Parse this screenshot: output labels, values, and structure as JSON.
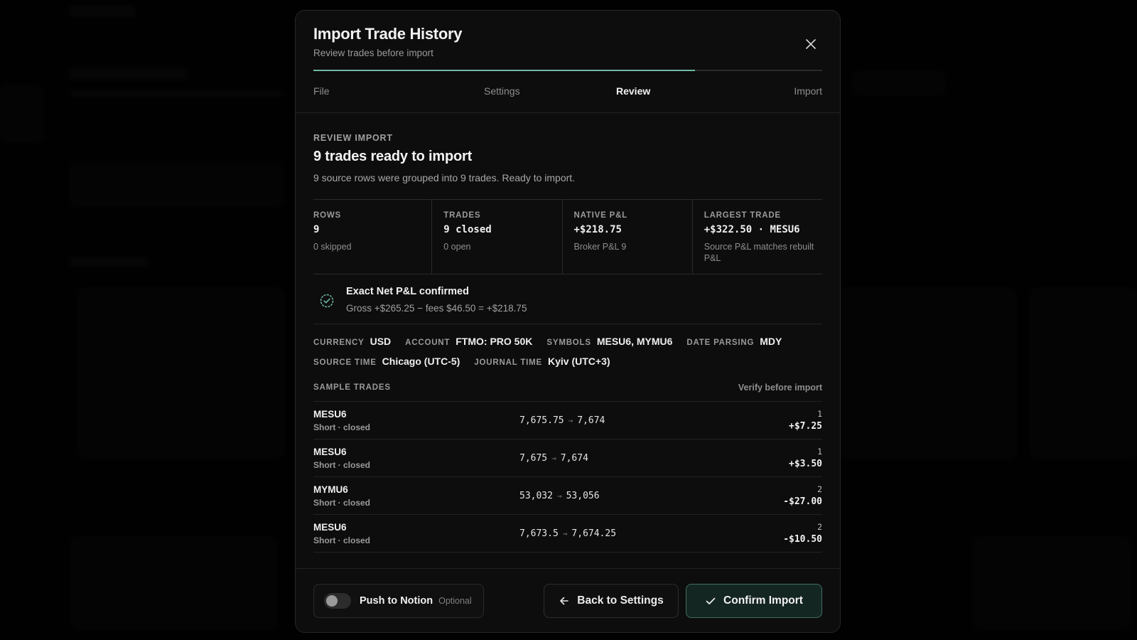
{
  "modal": {
    "title": "Import Trade History",
    "subtitle": "Review trades before import",
    "accent_color": "#6fb8a5",
    "progress_fraction": 0.75
  },
  "steps": [
    {
      "label": "File",
      "active": false
    },
    {
      "label": "Settings",
      "active": false
    },
    {
      "label": "Review",
      "active": true
    },
    {
      "label": "Import",
      "active": false
    }
  ],
  "review": {
    "eyebrow": "REVIEW IMPORT",
    "heading": "9 trades ready to import",
    "description": "9 source rows were grouped into 9 trades. Ready to import."
  },
  "stats": [
    {
      "label": "ROWS",
      "value": "9",
      "sub": "0 skipped"
    },
    {
      "label": "TRADES",
      "value": "9 closed",
      "sub": "0 open"
    },
    {
      "label": "NATIVE P&L",
      "value": "+$218.75",
      "sub": "Broker P&L 9"
    },
    {
      "label": "LARGEST TRADE",
      "value": "+$322.50 · MESU6",
      "sub": "Source P&L matches rebuilt P&L"
    }
  ],
  "confirmation": {
    "icon": "check-circle-icon",
    "title": "Exact Net P&L confirmed",
    "formula": "Gross +$265.25 − fees $46.50 = +$218.75"
  },
  "meta": {
    "line1": [
      {
        "key": "CURRENCY",
        "value": "USD"
      },
      {
        "key": "ACCOUNT",
        "value": "FTMO: PRO 50K"
      },
      {
        "key": "SYMBOLS",
        "value": "MESU6, MYMU6"
      },
      {
        "key": "DATE PARSING",
        "value": "MDY"
      }
    ],
    "line2": [
      {
        "key": "SOURCE TIME",
        "value": "Chicago (UTC-5)"
      },
      {
        "key": "JOURNAL TIME",
        "value": "Kyiv (UTC+3)"
      }
    ]
  },
  "samples": {
    "title": "SAMPLE TRADES",
    "note": "Verify before import",
    "rows": [
      {
        "symbol": "MESU6",
        "side": "Short · closed",
        "entry": "7,675.75",
        "exit": "7,674",
        "qty": "1",
        "pnl": "+$7.25"
      },
      {
        "symbol": "MESU6",
        "side": "Short · closed",
        "entry": "7,675",
        "exit": "7,674",
        "qty": "1",
        "pnl": "+$3.50"
      },
      {
        "symbol": "MYMU6",
        "side": "Short · closed",
        "entry": "53,032",
        "exit": "53,056",
        "qty": "2",
        "pnl": "-$27.00"
      },
      {
        "symbol": "MESU6",
        "side": "Short · closed",
        "entry": "7,673.5",
        "exit": "7,674.25",
        "qty": "2",
        "pnl": "-$10.50"
      }
    ]
  },
  "footer": {
    "notion_label": "Push to Notion",
    "notion_optional": "Optional",
    "notion_enabled": false,
    "back_label": "Back to Settings",
    "confirm_label": "Confirm Import"
  }
}
